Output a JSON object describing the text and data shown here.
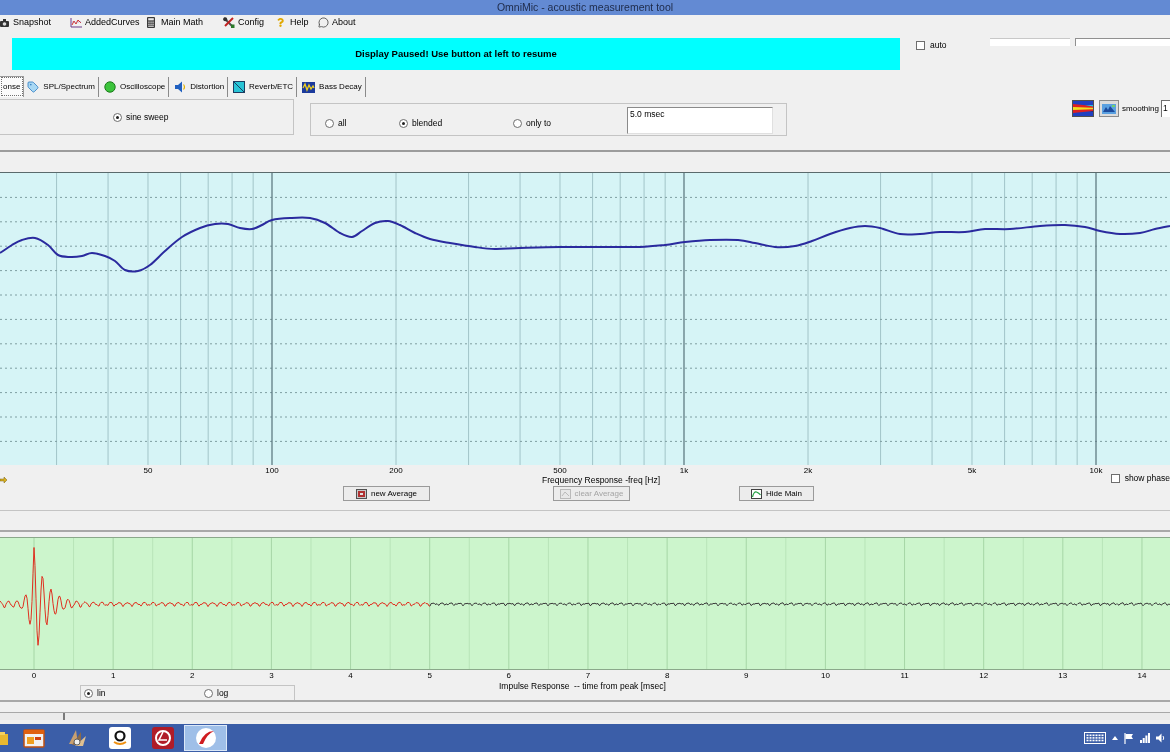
{
  "window": {
    "title": "OmniMic - acoustic measurement tool"
  },
  "menu": [
    "Snapshot",
    "AddedCurves",
    "Main Math",
    "Config",
    "Help",
    "About"
  ],
  "banner": {
    "message": "Display Paused! Use button at left to resume"
  },
  "auto": {
    "label": "auto",
    "checked": false
  },
  "tabs": [
    {
      "label": "onse",
      "selected": true
    },
    {
      "label": "SPL/Spectrum",
      "selected": false
    },
    {
      "label": "Oscilloscope",
      "selected": false
    },
    {
      "label": "Distortion",
      "selected": false
    },
    {
      "label": "Reverb/ETC",
      "selected": false
    },
    {
      "label": "Bass Decay",
      "selected": false
    }
  ],
  "source": [
    {
      "label": "sine sweep",
      "selected": true
    }
  ],
  "window_mode": [
    {
      "label": "all",
      "selected": false
    },
    {
      "label": "blended",
      "selected": true
    },
    {
      "label": "only to",
      "selected": false
    }
  ],
  "window_time": {
    "value": "5.0 msec"
  },
  "smoothing": {
    "label": "smoothing",
    "value": "1"
  },
  "frequency_plot": {
    "x_tick_labels": [
      "50",
      "100",
      "200",
      "500",
      "1k",
      "2k",
      "5k",
      "10k"
    ],
    "axis_title": "Frequency Response -freq [Hz]"
  },
  "show_phase": {
    "label": "show phase",
    "checked": false
  },
  "buttons": [
    {
      "label": "new Average",
      "disabled": false
    },
    {
      "label": "clear Average",
      "disabled": true
    },
    {
      "label": "Hide Main",
      "disabled": false
    }
  ],
  "impulse_plot": {
    "x_tick_labels": [
      "0",
      "1",
      "2",
      "3",
      "4",
      "5",
      "6",
      "7",
      "8",
      "9",
      "10",
      "11",
      "12",
      "13",
      "14"
    ],
    "axis_title": "Impulse Response  -- time from peak [msec]"
  },
  "scale": [
    {
      "label": "lin",
      "selected": true
    },
    {
      "label": "log",
      "selected": false
    }
  ],
  "taskbar_apps": [
    {
      "selected": false
    },
    {
      "selected": false
    },
    {
      "selected": false
    },
    {
      "selected": false
    },
    {
      "selected": false
    },
    {
      "selected": true
    }
  ]
}
